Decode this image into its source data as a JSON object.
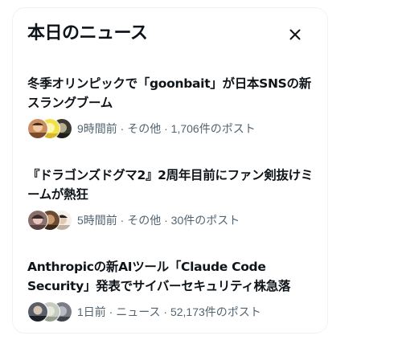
{
  "header": {
    "title": "本日のニュース",
    "close_icon": "close-icon"
  },
  "news": [
    {
      "title": "冬季オリンピックで「goonbait」が日本SNSの新スラングブーム",
      "meta": "9時間前 · その他 · 1,706件のポスト",
      "avatar_icons": [
        "avatar-photo",
        "avatar-photo",
        "avatar-photo"
      ]
    },
    {
      "title": "『ドラゴンズドグマ2』2周年目前にファン剣抜けミームが熱狂",
      "meta": "5時間前 · その他 · 30件のポスト",
      "avatar_icons": [
        "avatar-photo",
        "avatar-photo",
        "avatar-photo"
      ]
    },
    {
      "title": "Anthropicの新AIツール「Claude Code Security」発表でサイバーセキュリティ株急落",
      "meta": "1日前 · ニュース · 52,173件のポスト",
      "avatar_icons": [
        "avatar-photo",
        "avatar-photo",
        "avatar-photo"
      ]
    }
  ],
  "colors": {
    "text_primary": "#0f1419",
    "text_secondary": "#536471",
    "border": "#eff3f4"
  }
}
